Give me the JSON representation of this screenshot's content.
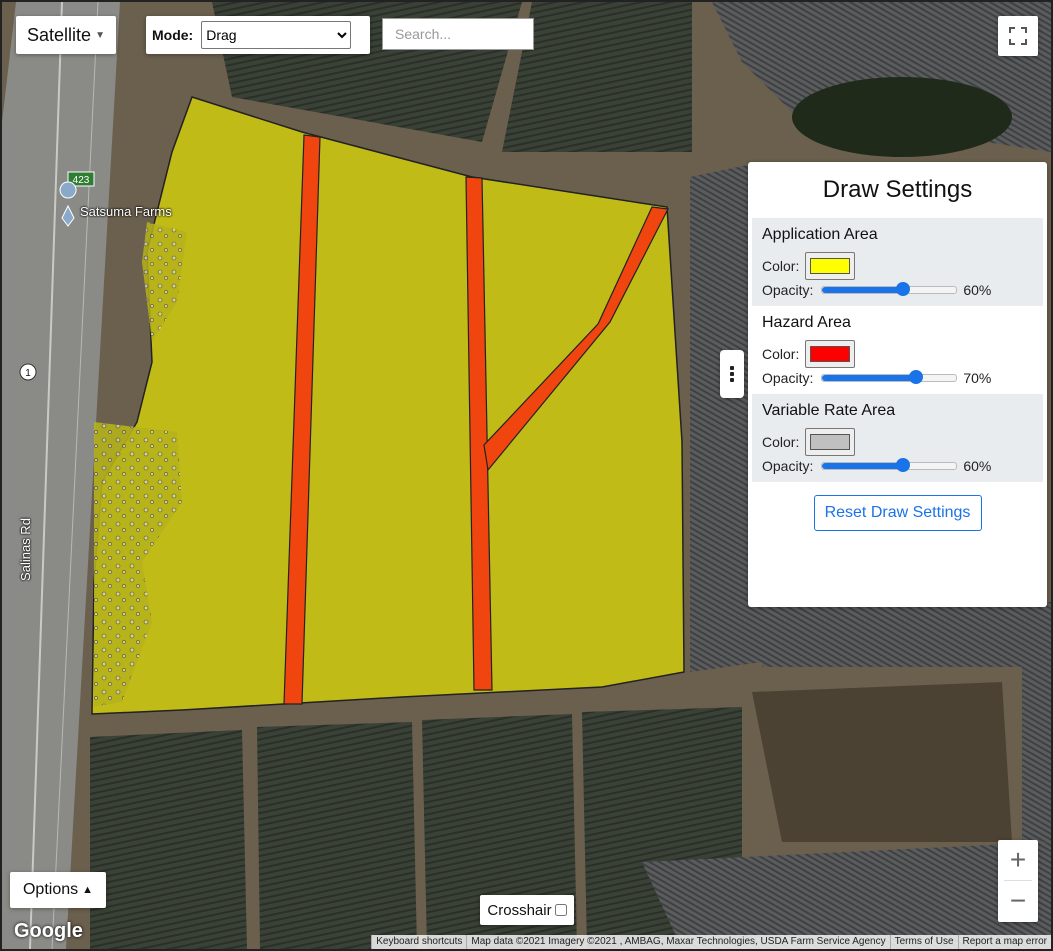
{
  "map": {
    "type_button": "Satellite",
    "place_label": "Satsuma Farms",
    "road_label": "Salinas Rd",
    "hwy_badge": "423",
    "route_badge": "1",
    "logo": "Google",
    "attribution": [
      "Keyboard shortcuts",
      "Map data ©2021 Imagery ©2021 , AMBAG, Maxar Technologies, USDA Farm Service Agency",
      "Terms of Use",
      "Report a map error"
    ]
  },
  "toolbar": {
    "mode_label": "Mode:",
    "mode_selected": "Drag",
    "search_placeholder": "Search..."
  },
  "draw_settings": {
    "title": "Draw Settings",
    "color_label": "Color:",
    "opacity_label": "Opacity:",
    "sections": [
      {
        "name": "Application Area",
        "color": "#ffff00",
        "opacity": 60,
        "opacity_text": "60%"
      },
      {
        "name": "Hazard Area",
        "color": "#ff0000",
        "opacity": 70,
        "opacity_text": "70%"
      },
      {
        "name": "Variable Rate Area",
        "color": "#c0c0c0",
        "opacity": 60,
        "opacity_text": "60%"
      }
    ],
    "reset_label": "Reset Draw Settings"
  },
  "bottom": {
    "options_label": "Options",
    "crosshair_label": "Crosshair",
    "zoom_in": "+",
    "zoom_out": "−"
  }
}
